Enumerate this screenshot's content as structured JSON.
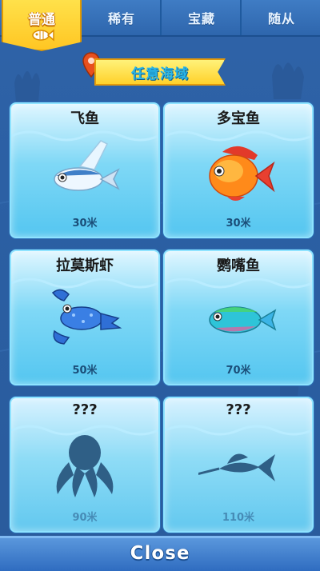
{
  "tabs": [
    {
      "label": "普通",
      "active": true,
      "icon": "fish-icon"
    },
    {
      "label": "稀有",
      "active": false
    },
    {
      "label": "宝藏",
      "active": false
    },
    {
      "label": "随从",
      "active": false
    }
  ],
  "region": {
    "label": "任意海域",
    "icon": "location-pin-icon"
  },
  "cards": [
    {
      "name": "飞鱼",
      "distance": "30米",
      "locked": false,
      "icon": "flying-fish-icon"
    },
    {
      "name": "多宝鱼",
      "distance": "30米",
      "locked": false,
      "icon": "orange-fish-icon"
    },
    {
      "name": "拉莫斯虾",
      "distance": "50米",
      "locked": false,
      "icon": "lobster-icon"
    },
    {
      "name": "鹦嘴鱼",
      "distance": "70米",
      "locked": false,
      "icon": "parrotfish-icon"
    },
    {
      "name": "???",
      "distance": "90米",
      "locked": true,
      "icon": "octopus-silhouette-icon"
    },
    {
      "name": "???",
      "distance": "110米",
      "locked": true,
      "icon": "swordfish-silhouette-icon"
    }
  ],
  "footer": {
    "close_label": "Close"
  },
  "colors": {
    "accent": "#ffc623",
    "card": "#7fd8f6",
    "background": "#2f63a8"
  }
}
